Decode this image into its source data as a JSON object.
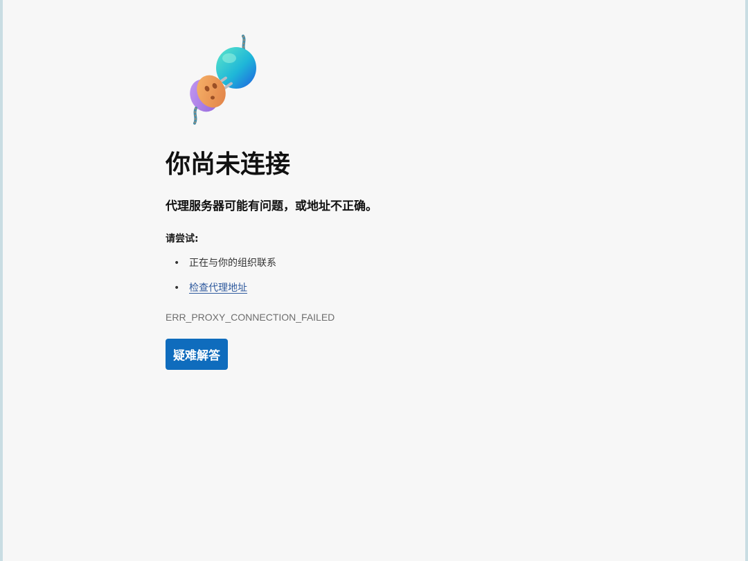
{
  "page": {
    "title": "你尚未连接",
    "subtitle": "代理服务器可能有问题，或地址不正确。",
    "try_label": "请尝试:",
    "suggestions": [
      {
        "text": "正在与你的组织联系",
        "is_link": false
      },
      {
        "text": "检查代理地址",
        "is_link": true
      }
    ],
    "error_code": "ERR_PROXY_CONNECTION_FAILED",
    "troubleshoot_label": "疑难解答"
  },
  "icons": {
    "illustration": "unplugged-plug-icon"
  },
  "colors": {
    "background": "#f7f7f7",
    "button": "#0f6cbd",
    "link": "#2f5a9e",
    "error_code": "#6d6d6d"
  }
}
